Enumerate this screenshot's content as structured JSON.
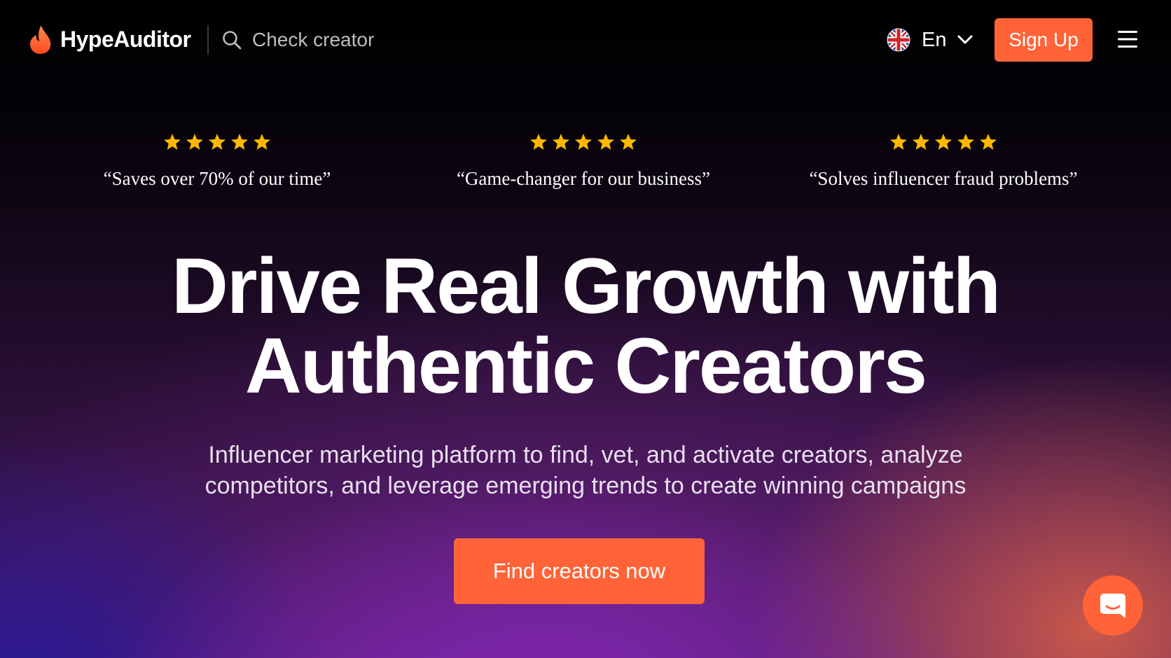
{
  "header": {
    "logo_text": "HypeAuditor",
    "search_placeholder": "Check creator",
    "language": "En",
    "signup_label": "Sign Up",
    "icons": {
      "logo": "flame-icon",
      "search": "search-icon",
      "language": "uk-flag-icon",
      "language_toggle": "chevron-down-icon",
      "menu": "hamburger-menu-icon"
    }
  },
  "testimonials": [
    {
      "rating": 5,
      "quote": "“Saves over 70% of our time”"
    },
    {
      "rating": 5,
      "quote": "“Game-changer for our business”"
    },
    {
      "rating": 5,
      "quote": "“Solves influencer fraud problems”"
    }
  ],
  "hero": {
    "headline_line1": "Drive Real Growth with",
    "headline_line2": "Authentic Creators",
    "subhead_line1": "Influencer marketing platform to find, vet, and activate creators, analyze",
    "subhead_line2": "competitors, and leverage emerging trends to create winning campaigns",
    "cta_label": "Find creators now"
  },
  "chat_widget": {
    "icon": "chat-bubble-icon"
  },
  "colors": {
    "accent": "#ff6337",
    "star": "#ffb800",
    "background_top": "#000000",
    "text": "#ffffff"
  }
}
